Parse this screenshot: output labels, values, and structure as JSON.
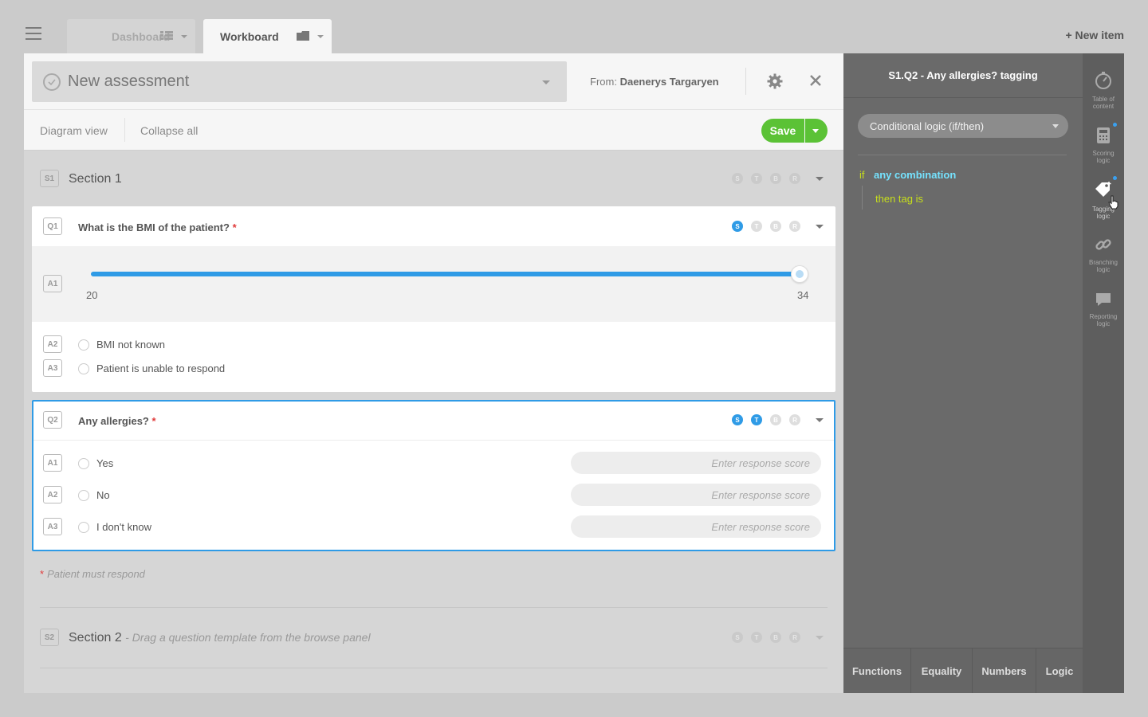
{
  "top": {
    "tabs": [
      {
        "label": "Dashboard"
      },
      {
        "label": "Workboard"
      }
    ],
    "new_item": "+ New item"
  },
  "header": {
    "title": "New assessment",
    "from_label": "From:",
    "from_name": "Daenerys Targaryen"
  },
  "toolbar": {
    "diagram_view": "Diagram view",
    "collapse_all": "Collapse all",
    "save": "Save"
  },
  "logic_letters": [
    "S",
    "T",
    "B",
    "R"
  ],
  "section1": {
    "id": "S1",
    "title": "Section 1"
  },
  "q1": {
    "id": "Q1",
    "title": "What is the BMI of the patient?",
    "required_mark": "*",
    "slider": {
      "id": "A1",
      "min": "20",
      "max": "34",
      "fill_fraction": 1.0
    },
    "answers": [
      {
        "id": "A2",
        "label": "BMI not known"
      },
      {
        "id": "A3",
        "label": "Patient is unable to respond"
      }
    ]
  },
  "q2": {
    "id": "Q2",
    "title": "Any allergies?",
    "required_mark": "*",
    "answers": [
      {
        "id": "A1",
        "label": "Yes",
        "placeholder": "Enter response score"
      },
      {
        "id": "A2",
        "label": "No",
        "placeholder": "Enter response score"
      },
      {
        "id": "A3",
        "label": "I don't know",
        "placeholder": "Enter response score"
      }
    ]
  },
  "note": {
    "mark": "*",
    "text": "Patient must respond"
  },
  "section2": {
    "id": "S2",
    "title": "Section 2",
    "subtitle": "- Drag a question template from the browse panel"
  },
  "right_panel": {
    "title": "S1.Q2 - Any allergies? tagging",
    "select_value": "Conditional logic (if/then)",
    "if_kw": "if",
    "condition": "any combination",
    "then_kw": "then tag is",
    "footer": [
      "Functions",
      "Equality",
      "Numbers",
      "Logic"
    ]
  },
  "rail": {
    "items": [
      {
        "label1": "Table of",
        "label2": "content"
      },
      {
        "label1": "Scoring",
        "label2": "logic"
      },
      {
        "label1": "Tagging",
        "label2": "logic"
      },
      {
        "label1": "Branching",
        "label2": "logic"
      },
      {
        "label1": "Reporting",
        "label2": "logic"
      }
    ]
  },
  "colors": {
    "accent_blue": "#2f9be6",
    "save_green": "#5bc236",
    "required_red": "#e03b3b",
    "logic_yellow": "#c7df1b",
    "logic_cyan": "#75e3ff"
  }
}
